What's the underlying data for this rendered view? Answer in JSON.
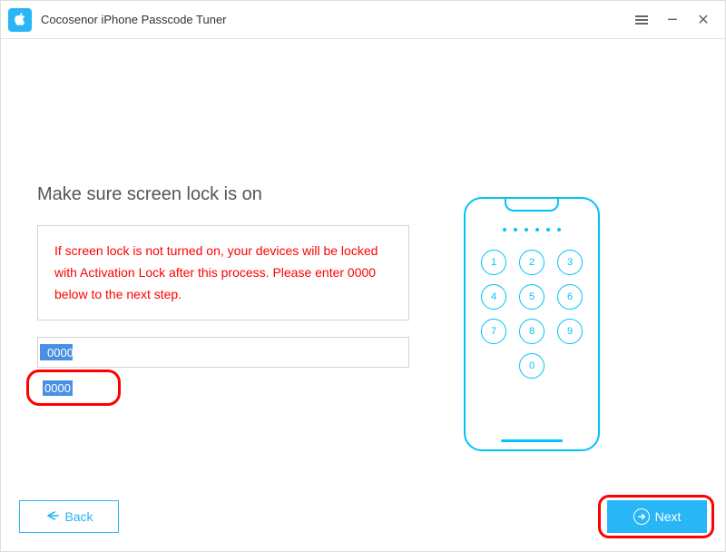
{
  "app": {
    "title": "Cocosenor iPhone Passcode Tuner"
  },
  "main": {
    "heading": "Make sure screen lock is on",
    "warning": "If screen lock is not turned on, your devices will be locked with Activation Lock after this process. Please enter 0000 below to the next step.",
    "input_value": "0000"
  },
  "keypad": {
    "keys": [
      "1",
      "2",
      "3",
      "4",
      "5",
      "6",
      "7",
      "8",
      "9",
      "0"
    ]
  },
  "footer": {
    "back_label": "Back",
    "next_label": "Next"
  }
}
